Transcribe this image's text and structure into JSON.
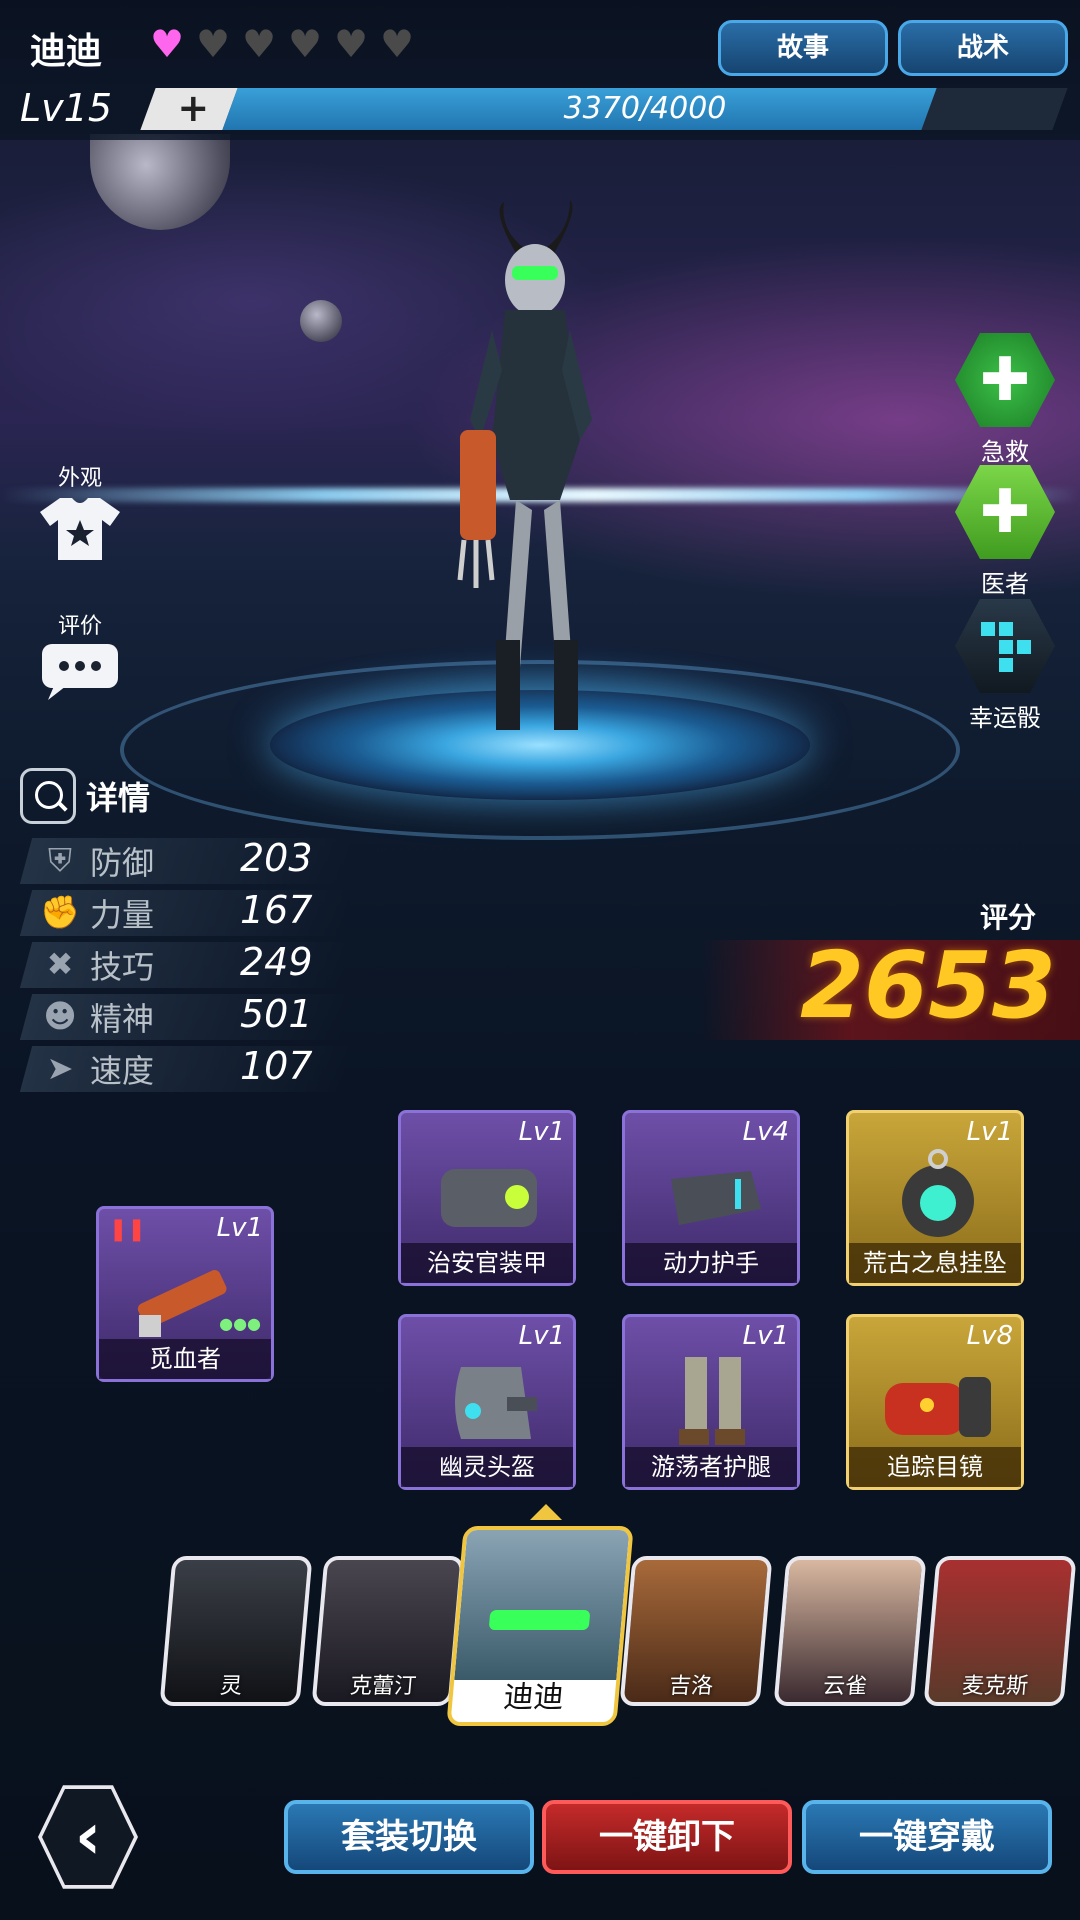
{
  "header": {
    "character_name": "迪迪",
    "hearts_total": 6,
    "hearts_filled": 1,
    "story_button": "故事",
    "tactics_button": "战术",
    "level": "Lv15",
    "plus_label": "+",
    "xp_text": "3370/4000",
    "xp_fraction": 0.8425
  },
  "left_actions": {
    "appearance_label": "外观",
    "review_label": "评价"
  },
  "right_actions": {
    "first_aid_label": "急救",
    "doctor_label": "医者",
    "lucky_dice_label": "幸运骰"
  },
  "stats": {
    "details_label": "详情",
    "rows": [
      {
        "name": "防御",
        "value": "203",
        "icon": "shield-icon"
      },
      {
        "name": "力量",
        "value": "167",
        "icon": "fist-icon"
      },
      {
        "name": "技巧",
        "value": "249",
        "icon": "tools-icon"
      },
      {
        "name": "精神",
        "value": "501",
        "icon": "mind-icon"
      },
      {
        "name": "速度",
        "value": "107",
        "icon": "speed-icon"
      }
    ]
  },
  "score": {
    "label": "评分",
    "value": "2653"
  },
  "equipment": {
    "weapon": {
      "name": "觅血者",
      "level": "Lv1"
    },
    "slots": [
      {
        "name": "治安官装甲",
        "level": "Lv1",
        "rarity": "purple"
      },
      {
        "name": "动力护手",
        "level": "Lv4",
        "rarity": "purple"
      },
      {
        "name": "荒古之息挂坠",
        "level": "Lv1",
        "rarity": "gold"
      },
      {
        "name": "幽灵头盔",
        "level": "Lv1",
        "rarity": "purple"
      },
      {
        "name": "游荡者护腿",
        "level": "Lv1",
        "rarity": "purple"
      },
      {
        "name": "追踪目镜",
        "level": "Lv8",
        "rarity": "gold"
      }
    ]
  },
  "heroes": [
    {
      "name": "灵"
    },
    {
      "name": "克蕾汀"
    },
    {
      "name": "迪迪",
      "selected": true
    },
    {
      "name": "吉洛"
    },
    {
      "name": "云雀"
    },
    {
      "name": "麦克斯"
    }
  ],
  "bottom": {
    "switch_set": "套装切换",
    "unequip_all": "一键卸下",
    "equip_all": "一键穿戴"
  },
  "colors": {
    "heart_on": "#ff66ee",
    "score": "#ffc822",
    "purple_frame": "#8a72d8",
    "gold_frame": "#f0d070"
  }
}
